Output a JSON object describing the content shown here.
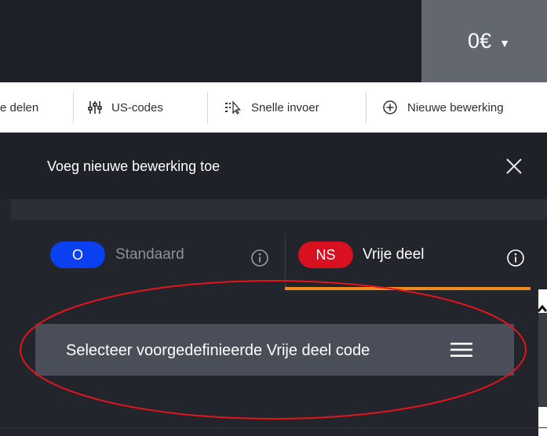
{
  "header": {
    "price": "0€"
  },
  "toolbar": {
    "items": [
      {
        "label": "e delen",
        "icon": "none"
      },
      {
        "label": "US-codes",
        "icon": "sliders-icon"
      },
      {
        "label": "Snelle invoer",
        "icon": "quick-input-icon"
      },
      {
        "label": "Nieuwe bewerking",
        "icon": "plus-circle-icon"
      }
    ]
  },
  "panel": {
    "title": "Voeg nieuwe bewerking toe",
    "tabs": [
      {
        "badge": "O",
        "label": "Standaard",
        "badge_color": "#0a40f0",
        "active": false
      },
      {
        "badge": "NS",
        "label": "Vrije deel",
        "badge_color": "#d9101f",
        "active": true
      }
    ],
    "select_button": {
      "label": "Selecteer voorgedefinieerde Vrije deel code"
    }
  },
  "colors": {
    "accent_underline": "#f08a1d",
    "annotation_circle": "#e3151b"
  }
}
